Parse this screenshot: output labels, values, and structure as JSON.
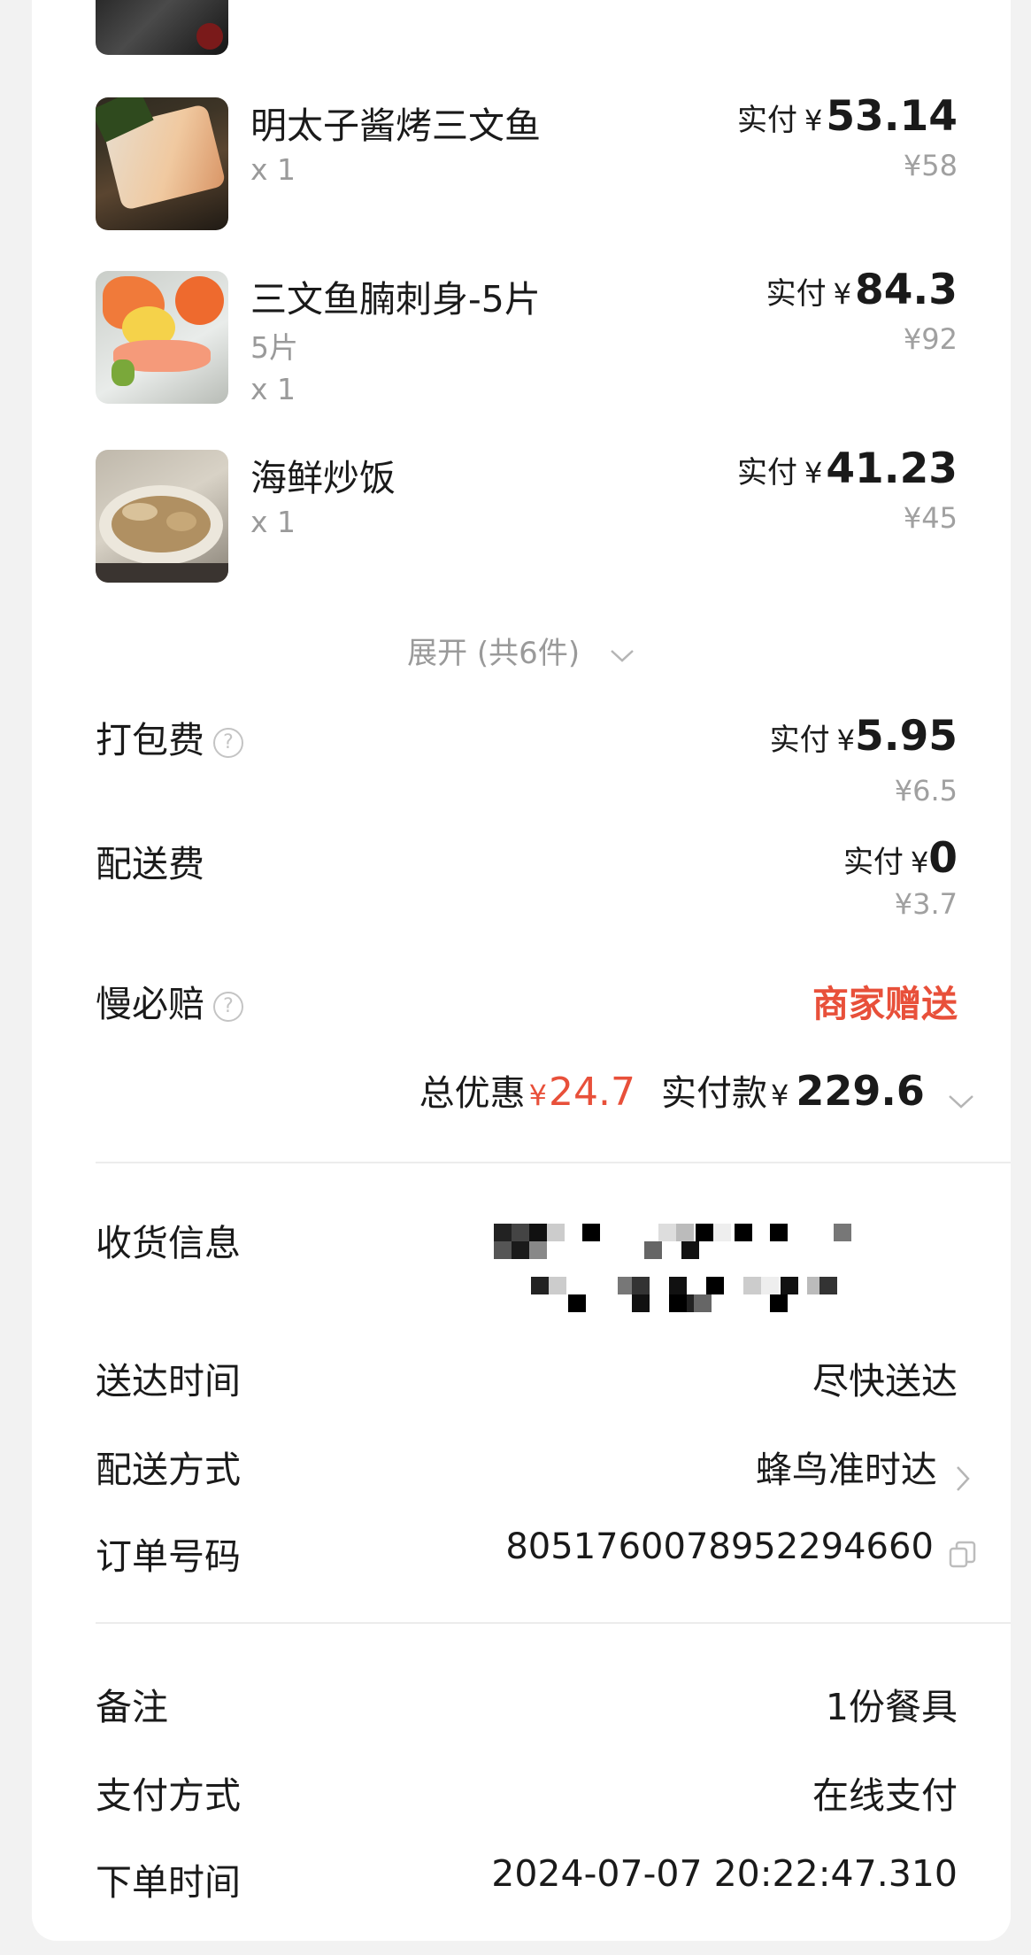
{
  "items": [
    {
      "name": "明太子酱烤三文鱼",
      "spec": "",
      "qty": "x 1",
      "paid_label": "实付",
      "currency": "¥",
      "paid": "53.14",
      "original": "¥58"
    },
    {
      "name": "三文鱼腩刺身-5片",
      "spec": "5片",
      "qty": "x 1",
      "paid_label": "实付",
      "currency": "¥",
      "paid": "84.3",
      "original": "¥92"
    },
    {
      "name": "海鲜炒饭",
      "spec": "",
      "qty": "x 1",
      "paid_label": "实付",
      "currency": "¥",
      "paid": "41.23",
      "original": "¥45"
    }
  ],
  "expand_label": "展开 (共6件)",
  "fees": {
    "packing": {
      "label": "打包费",
      "paid_label": "实付",
      "currency": "¥",
      "paid": "5.95",
      "original": "¥6.5"
    },
    "delivery": {
      "label": "配送费",
      "paid_label": "实付",
      "currency": "¥",
      "paid": "0",
      "original": "¥3.7"
    },
    "late_guarantee": {
      "label": "慢必赔",
      "value": "商家赠送"
    }
  },
  "summary": {
    "discount_label": "总优惠",
    "discount_currency": "¥",
    "discount": "24.7",
    "total_label": "实付款",
    "total_currency": "¥",
    "total": "229.6"
  },
  "info": {
    "address_label": "收货信息",
    "time_label": "送达时间",
    "time_value": "尽快送达",
    "method_label": "配送方式",
    "method_value": "蜂鸟准时达",
    "order_label": "订单号码",
    "order_value": "8051760078952294660"
  },
  "extra": {
    "note_label": "备注",
    "note_value": "1份餐具",
    "pay_label": "支付方式",
    "pay_value": "在线支付",
    "order_time_label": "下单时间",
    "order_time_value": "2024-07-07 20:22:47.310"
  },
  "colors": {
    "accent_red": "#e8503a",
    "muted": "#9a9a9a",
    "background": "#f2f2f2"
  },
  "icons": [
    "question-circle-icon",
    "chevron-down-icon",
    "chevron-right-icon",
    "copy-icon"
  ]
}
